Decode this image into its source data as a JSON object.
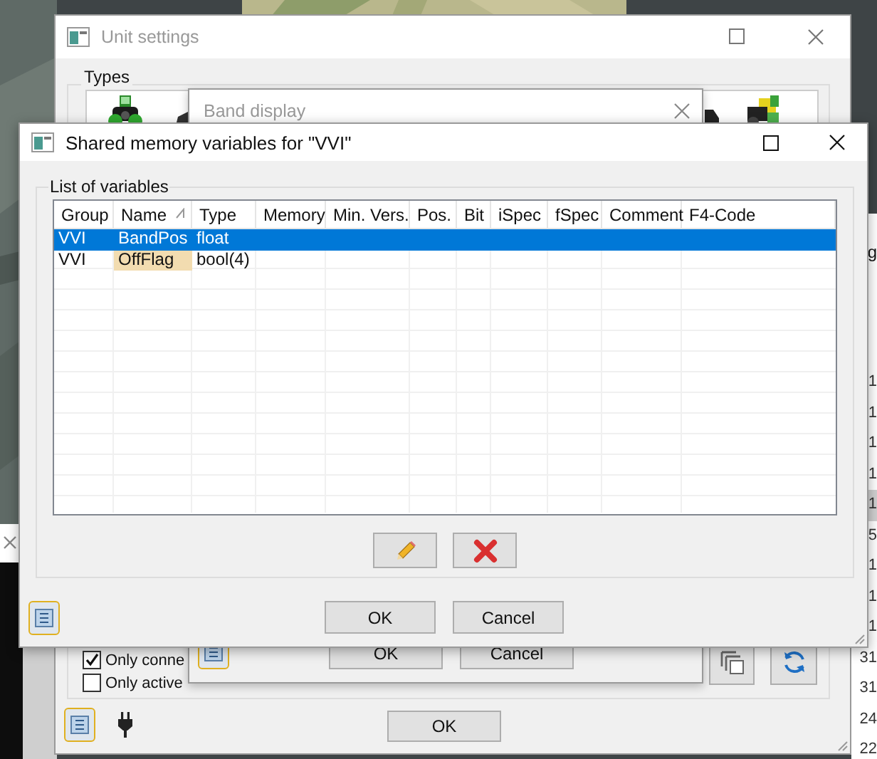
{
  "unit_settings": {
    "title": "Unit settings",
    "group_label": "Types",
    "checkboxes": [
      {
        "label": "Only conne",
        "checked": true
      },
      {
        "label": "Only active",
        "checked": false
      }
    ],
    "ok_button": "OK"
  },
  "band_display": {
    "title": "Band display",
    "buttons": [
      "OK",
      "Cancel"
    ]
  },
  "side_window": {
    "header": "g",
    "values": [
      {
        "text": "1",
        "selected": false
      },
      {
        "text": "1",
        "selected": false
      },
      {
        "text": "1",
        "selected": false
      },
      {
        "text": "1",
        "selected": false
      },
      {
        "text": "1",
        "selected": true
      },
      {
        "text": "5",
        "selected": false
      },
      {
        "text": "1",
        "selected": false
      },
      {
        "text": "1",
        "selected": false
      },
      {
        "text": "1",
        "selected": false
      },
      {
        "text": "31",
        "selected": false
      },
      {
        "text": "31",
        "selected": false
      },
      {
        "text": "24",
        "selected": false
      },
      {
        "text": "22",
        "selected": false
      }
    ]
  },
  "dialog": {
    "title": "Shared memory variables for \"VVI\"",
    "group_label": "List of variables",
    "columns": [
      {
        "label": "Group",
        "sorted": false
      },
      {
        "label": "Name",
        "sorted": true
      },
      {
        "label": "Type",
        "sorted": false
      },
      {
        "label": "Memory",
        "sorted": false
      },
      {
        "label": "Min. Vers.",
        "sorted": false
      },
      {
        "label": "Pos.",
        "sorted": false
      },
      {
        "label": "Bit",
        "sorted": false
      },
      {
        "label": "iSpec",
        "sorted": false
      },
      {
        "label": "fSpec",
        "sorted": false
      },
      {
        "label": "Comment",
        "sorted": false
      },
      {
        "label": "F4-Code",
        "sorted": false
      }
    ],
    "rows": [
      {
        "selected": true,
        "cells": [
          {
            "text": "VVI",
            "highlighted": false
          },
          {
            "text": "BandPos",
            "highlighted": false
          },
          {
            "text": "float",
            "highlighted": false
          }
        ]
      },
      {
        "selected": false,
        "cells": [
          {
            "text": "VVI",
            "highlighted": false
          },
          {
            "text": "OffFlag",
            "highlighted": true
          },
          {
            "text": "bool(4)",
            "highlighted": false
          }
        ]
      }
    ],
    "buttons": [
      "OK",
      "Cancel"
    ]
  }
}
